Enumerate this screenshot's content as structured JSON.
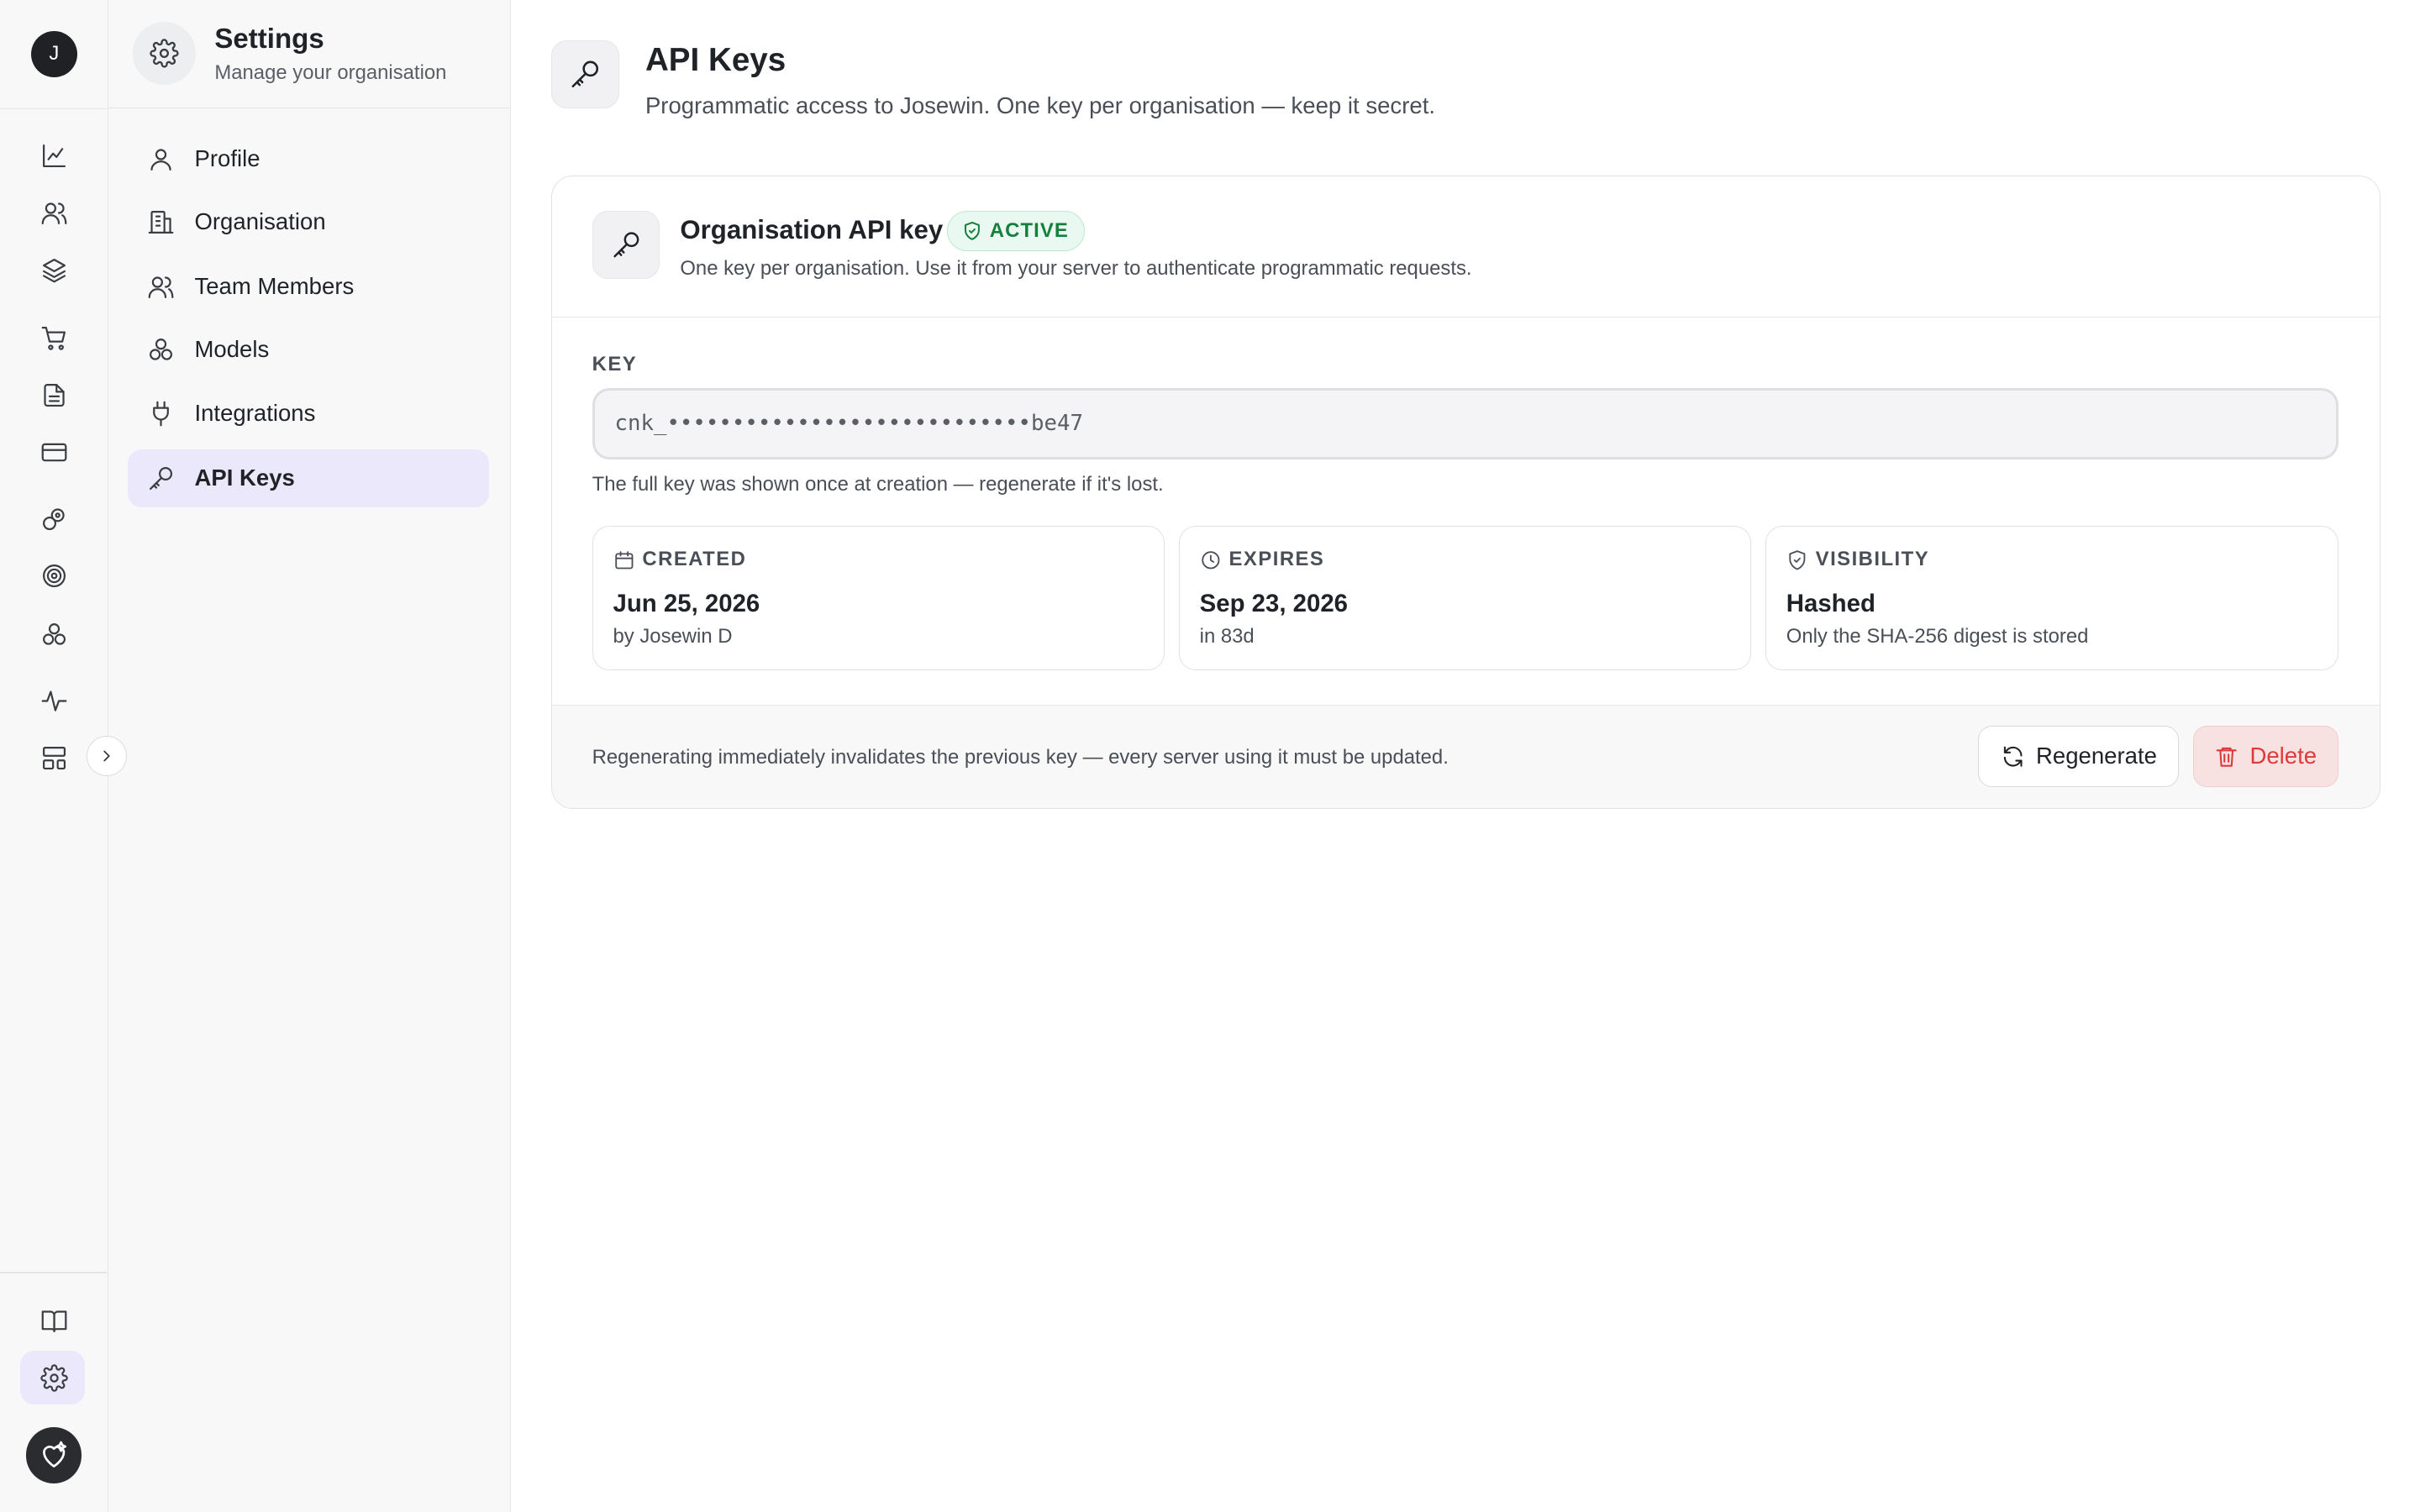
{
  "rail": {
    "avatar_initial": "J",
    "icons": [
      "chart-line-icon",
      "users-icon",
      "layers-icon",
      "cart-icon",
      "document-icon",
      "credit-card-icon",
      "link-icon",
      "target-icon",
      "models-icon",
      "activity-icon",
      "layout-icon",
      "book-icon",
      "settings-icon"
    ],
    "active_icon": "settings-icon"
  },
  "sidebar": {
    "title": "Settings",
    "subtitle": "Manage your organisation",
    "items": [
      {
        "label": "Profile",
        "icon": "user-icon"
      },
      {
        "label": "Organisation",
        "icon": "building-icon"
      },
      {
        "label": "Team Members",
        "icon": "users-icon"
      },
      {
        "label": "Models",
        "icon": "models-icon"
      },
      {
        "label": "Integrations",
        "icon": "plug-icon"
      },
      {
        "label": "API Keys",
        "icon": "key-icon",
        "active": true
      }
    ]
  },
  "page": {
    "title": "API Keys",
    "subtitle": "Programmatic access to Josewin. One key per organisation — keep it secret."
  },
  "card": {
    "title": "Organisation API key",
    "status": "ACTIVE",
    "description": "One key per organisation. Use it from your server to authenticate programmatic requests.",
    "key_label": "KEY",
    "key_value": "cnk_••••••••••••••••••••••••••••be47",
    "key_hint": "The full key was shown once at creation — regenerate if it's lost.",
    "created": {
      "label": "CREATED",
      "value": "Jun 25, 2026",
      "sub": "by Josewin D"
    },
    "expires": {
      "label": "EXPIRES",
      "value": "Sep 23, 2026",
      "sub": "in 83d"
    },
    "visibility": {
      "label": "VISIBILITY",
      "value": "Hashed",
      "sub": "Only the SHA-256 digest is stored"
    },
    "footer_text": "Regenerating immediately invalidates the previous key — every server using it must be updated.",
    "regenerate_label": "Regenerate",
    "delete_label": "Delete"
  },
  "colors": {
    "accent_active_bg": "#ebe8fb",
    "active_badge": "#15803d",
    "danger": "#dc3b3b"
  }
}
